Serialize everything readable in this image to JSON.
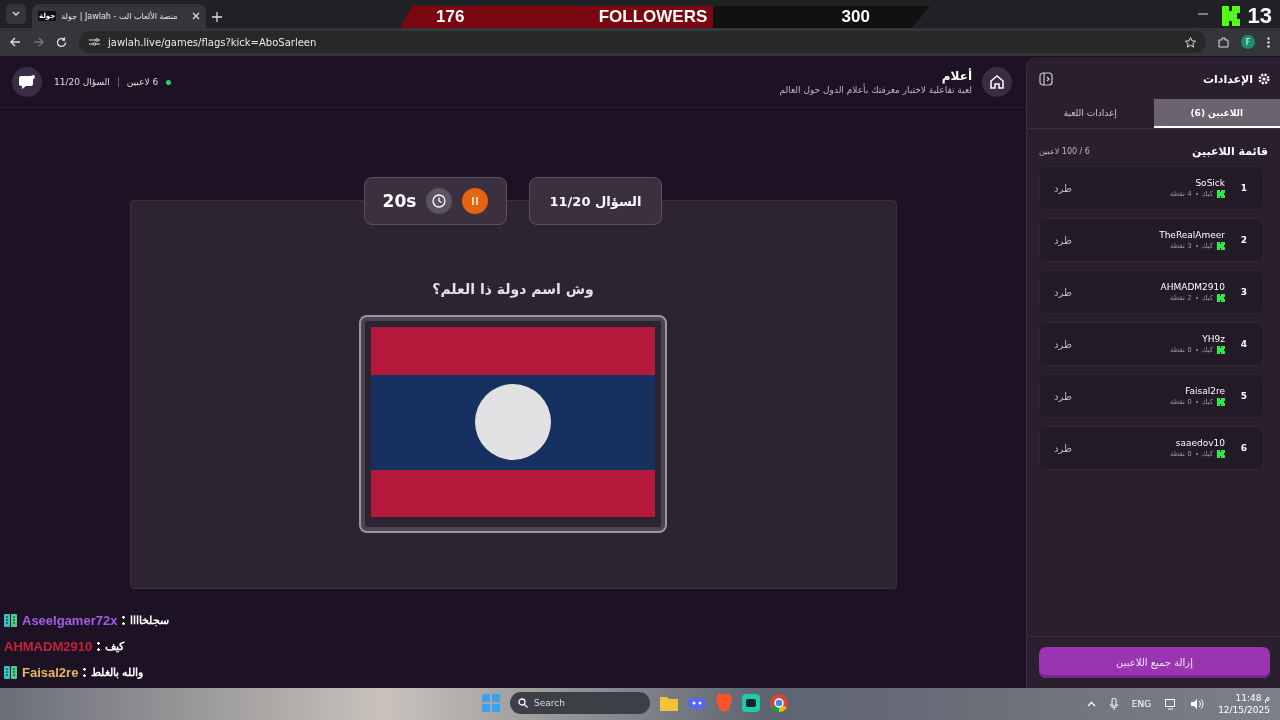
{
  "browser": {
    "favicon_text": "جولة",
    "tab_title": "جولة | Jawlah - منصة الألعاب الت",
    "url": "jawlah.live/games/flags?kick=AboSarleen",
    "profile_initial": "F"
  },
  "stream_overlay": {
    "followers_current": "176",
    "followers_label": "FOLLOWERS",
    "followers_goal": "300",
    "level": 0.59,
    "viewer_count": "13"
  },
  "game_header": {
    "title": "أعلام",
    "subtitle": "لعبة تفاعلية لاختبار معرفتك بأعلام الدول حول العالم",
    "players_status": "6 لاعبين",
    "question_status": "السؤال 11/20"
  },
  "board": {
    "timer": "20s",
    "question_counter": "السؤال 11/20",
    "question": "وش اسم دولة ذا العلم؟"
  },
  "sidebar": {
    "title": "الإعدادات",
    "tabs": [
      {
        "label": "اللاعبين (6)",
        "selected": true
      },
      {
        "label": "إعدادات اللعبة",
        "selected": false
      }
    ],
    "list_title": "قائمة اللاعبين",
    "count": "6 / 100 لاعبين",
    "players": [
      {
        "rank": "1",
        "name": "SoSick",
        "platform": "كيك",
        "points": "4 نقطة",
        "kick": "طرد"
      },
      {
        "rank": "2",
        "name": "TheRealAmeer",
        "platform": "كيك",
        "points": "3 نقطة",
        "kick": "طرد"
      },
      {
        "rank": "3",
        "name": "AHMADM2910",
        "platform": "كيك",
        "points": "2 نقطة",
        "kick": "طرد"
      },
      {
        "rank": "4",
        "name": "YH9z",
        "platform": "كيك",
        "points": "0 نقطة",
        "kick": "طرد"
      },
      {
        "rank": "5",
        "name": "Faisal2re",
        "platform": "كيك",
        "points": "0 نقطة",
        "kick": "طرد"
      },
      {
        "rank": "6",
        "name": "saaedov10",
        "platform": "كيك",
        "points": "0 نقطة",
        "kick": "طرد"
      }
    ],
    "remove_all": "إزالة جميع اللاعبين"
  },
  "chat": [
    {
      "badge": true,
      "user": "Aseelgamer72x",
      "color": "#a45ee5",
      "message": "سجلخاااا"
    },
    {
      "badge": false,
      "user": "AHMADM2910",
      "color": "#c8203c",
      "message": "كيف"
    },
    {
      "badge": true,
      "user": "Faisal2re",
      "color": "#e8b65e",
      "message": "والله بالغلط"
    }
  ],
  "taskbar": {
    "search": "Search",
    "language": "ENG",
    "time": "11:48 م",
    "date": "12/15/2025"
  }
}
